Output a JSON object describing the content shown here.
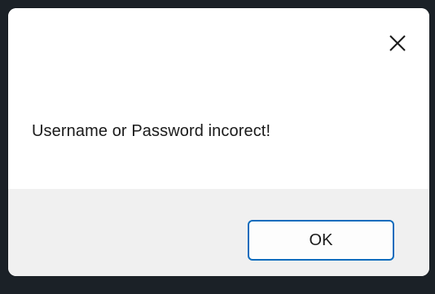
{
  "dialog": {
    "message": "Username or Password incorect!",
    "ok_label": "OK",
    "close_icon": "close-icon"
  },
  "colors": {
    "backdrop": "#1b2127",
    "dialog_background": "#ffffff",
    "footer_background": "#f0f0f0",
    "button_border_accent": "#0f6cbd"
  }
}
